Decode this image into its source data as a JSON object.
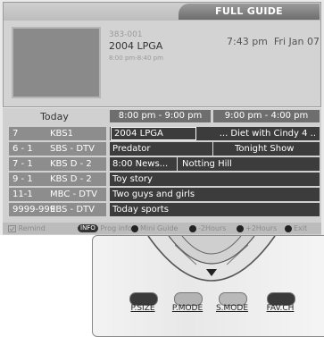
{
  "header": {
    "title": "FULL GUIDE"
  },
  "program": {
    "code": "383-001",
    "title": "2004 LPGA",
    "time": "8:00 pm-8:40 pm"
  },
  "clock": "7:43 pm  Fri Jan 07",
  "grid": {
    "date_label": "Today",
    "slots": [
      "8:00 pm - 9:00 pm",
      "9:00 pm - 4:00 pm"
    ],
    "rows": [
      {
        "number": "7",
        "name": "KBS1",
        "programs": [
          "2004 LPGA",
          "... Diet with Cindy 4 .."
        ]
      },
      {
        "number": "6 - 1",
        "name": "SBS - DTV",
        "programs": [
          "Predator",
          "Tonight Show"
        ]
      },
      {
        "number": "7 - 1",
        "name": "KBS D - 2",
        "programs": [
          "8:00 News...",
          "Notting Hill"
        ]
      },
      {
        "number": "9 - 1",
        "name": "KBS D - 2",
        "programs": [
          "Toy story"
        ]
      },
      {
        "number": "11-1",
        "name": "MBC - DTV",
        "programs": [
          "Two guys and girls"
        ]
      },
      {
        "number": "9999-999",
        "name": "EBS - DTV",
        "programs": [
          "Today sports"
        ]
      }
    ]
  },
  "legend": {
    "remind": "Remind",
    "info_badge": "INFO",
    "prog_info": "Prog info",
    "mini_guide": "Mini Guide",
    "minus_2hours": "-2Hours",
    "plus_2hours": "+2Hours",
    "exit": "Exit"
  },
  "remote": {
    "buttons": [
      {
        "label": "P.SIZE",
        "color": "#3a3a3a"
      },
      {
        "label": "P.MODE",
        "color": "#b3b3b3"
      },
      {
        "label": "S.MODE",
        "color": "#b9b9b9"
      },
      {
        "label": "FAV.CH",
        "color": "#3a3a3a"
      }
    ]
  }
}
